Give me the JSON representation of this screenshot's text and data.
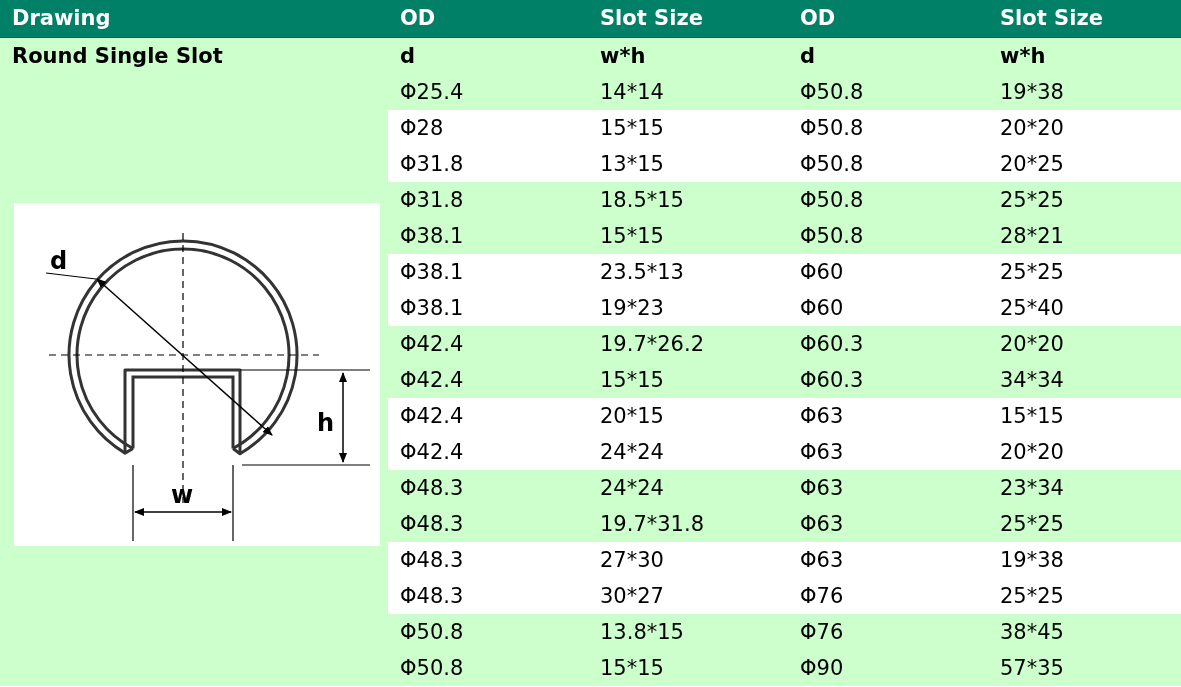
{
  "header": [
    "Drawing",
    "OD",
    "Slot Size",
    "OD",
    "Slot Size"
  ],
  "section": {
    "title": "Round Single Slot",
    "drawing": {
      "kind": "picture",
      "labels": {
        "diameter": "d",
        "height": "h",
        "width": "w"
      }
    }
  },
  "subheader": {
    "shaded": true,
    "cells": [
      "d",
      "w*h",
      "d",
      "w*h"
    ]
  },
  "rows": [
    {
      "shaded": true,
      "cells": [
        "Φ25.4",
        "14*14",
        "Φ50.8",
        "19*38"
      ]
    },
    {
      "shaded": false,
      "cells": [
        "Φ28",
        "15*15",
        "Φ50.8",
        "20*20"
      ]
    },
    {
      "shaded": false,
      "cells": [
        "Φ31.8",
        "13*15",
        "Φ50.8",
        "20*25"
      ]
    },
    {
      "shaded": true,
      "cells": [
        "Φ31.8",
        "18.5*15",
        "Φ50.8",
        "25*25"
      ]
    },
    {
      "shaded": true,
      "cells": [
        "Φ38.1",
        "15*15",
        "Φ50.8",
        "28*21"
      ]
    },
    {
      "shaded": false,
      "cells": [
        "Φ38.1",
        "23.5*13",
        "Φ60",
        "25*25"
      ]
    },
    {
      "shaded": false,
      "cells": [
        "Φ38.1",
        "19*23",
        "Φ60",
        "25*40"
      ]
    },
    {
      "shaded": true,
      "cells": [
        "Φ42.4",
        "19.7*26.2",
        "Φ60.3",
        "20*20"
      ]
    },
    {
      "shaded": true,
      "cells": [
        "Φ42.4",
        "15*15",
        "Φ60.3",
        "34*34"
      ]
    },
    {
      "shaded": false,
      "cells": [
        "Φ42.4",
        "20*15",
        "Φ63",
        "15*15"
      ]
    },
    {
      "shaded": false,
      "cells": [
        "Φ42.4",
        "24*24",
        "Φ63",
        "20*20"
      ]
    },
    {
      "shaded": true,
      "cells": [
        "Φ48.3",
        "24*24",
        "Φ63",
        "23*34"
      ]
    },
    {
      "shaded": true,
      "cells": [
        "Φ48.3",
        "19.7*31.8",
        "Φ63",
        "25*25"
      ]
    },
    {
      "shaded": false,
      "cells": [
        "Φ48.3",
        "27*30",
        "Φ63",
        "19*38"
      ]
    },
    {
      "shaded": false,
      "cells": [
        "Φ48.3",
        "30*27",
        "Φ76",
        "25*25"
      ]
    },
    {
      "shaded": true,
      "cells": [
        "Φ50.8",
        "13.8*15",
        "Φ76",
        "38*45"
      ]
    },
    {
      "shaded": true,
      "cells": [
        "Φ50.8",
        "15*15",
        "Φ90",
        "57*35"
      ]
    }
  ]
}
